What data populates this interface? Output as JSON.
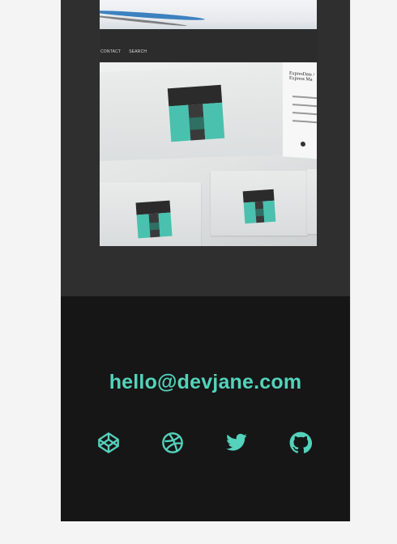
{
  "gallery": {
    "nav_items": [
      "CONTACT",
      "SEARCH"
    ],
    "side_panel_title": "ExpresDate / Express Ma"
  },
  "footer": {
    "email": "hello@devjane.com",
    "accent_color": "#54d2bb",
    "social": [
      {
        "name": "codepen",
        "icon": "codepen-icon"
      },
      {
        "name": "dribbble",
        "icon": "dribbble-icon"
      },
      {
        "name": "twitter",
        "icon": "twitter-icon"
      },
      {
        "name": "github",
        "icon": "github-icon"
      }
    ]
  }
}
